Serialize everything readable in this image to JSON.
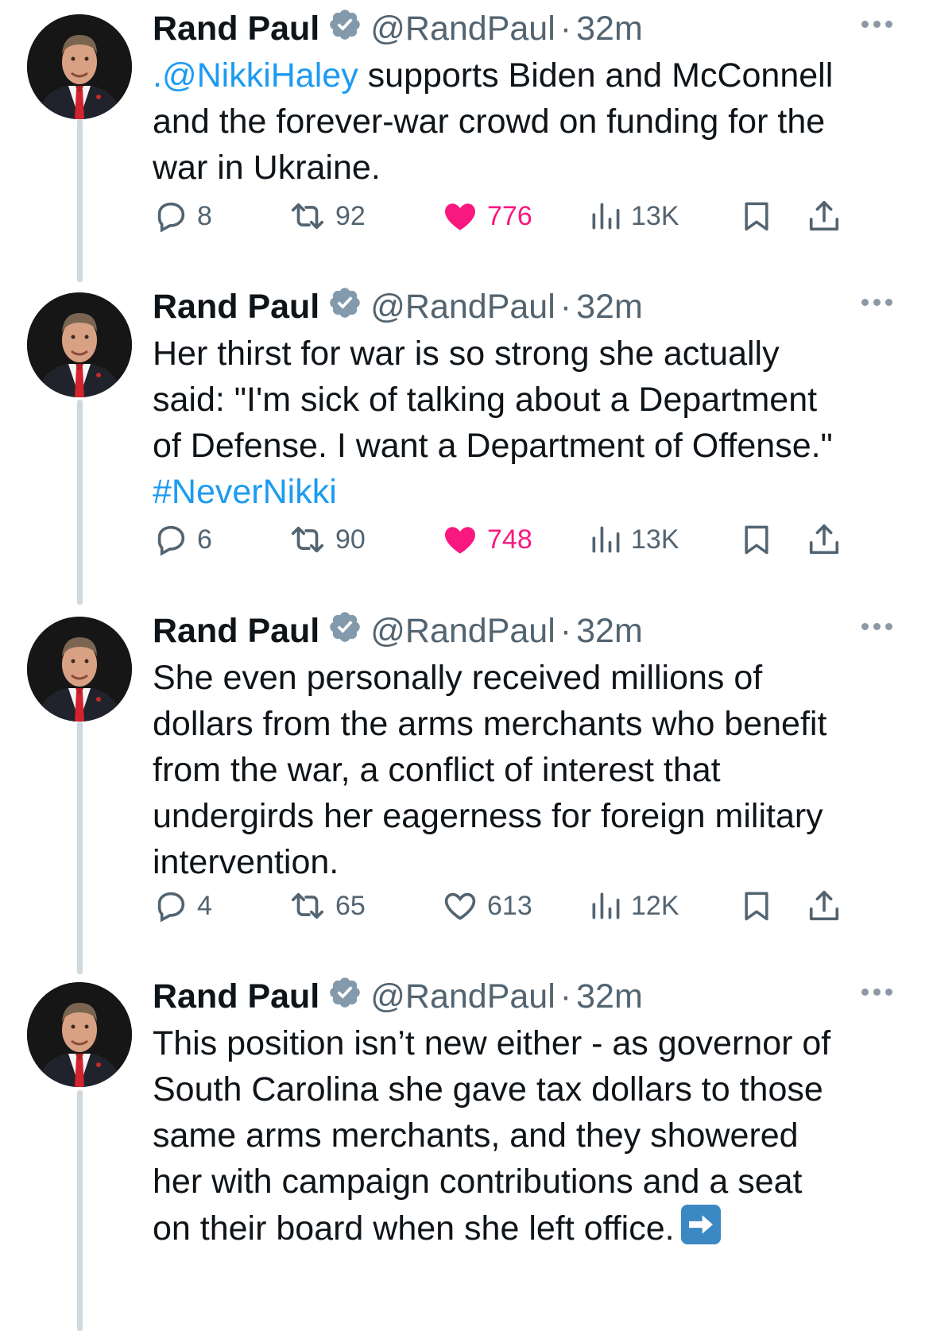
{
  "tweets": [
    {
      "author": "Rand Paul",
      "handle": "@RandPaul",
      "separator": "·",
      "time": "32m",
      "lines": [
        {
          "mention": ".@NikkiHaley",
          "text": " supports Biden and McConnell"
        },
        {
          "text": "and the forever-war crowd on funding for the"
        },
        {
          "text": "war in Ukraine."
        }
      ],
      "replies": "8",
      "reposts": "92",
      "likes": "776",
      "views": "13K",
      "liked": true
    },
    {
      "author": "Rand Paul",
      "handle": "@RandPaul",
      "separator": "·",
      "time": "32m",
      "lines": [
        {
          "text": "Her thirst for war is so strong she actually"
        },
        {
          "text": "said: \"I'm sick of talking about a Department"
        },
        {
          "text": "of Defense. I want a Department of Offense.\""
        },
        {
          "hashtag": "#NeverNikki"
        }
      ],
      "replies": "6",
      "reposts": "90",
      "likes": "748",
      "views": "13K",
      "liked": true
    },
    {
      "author": "Rand Paul",
      "handle": "@RandPaul",
      "separator": "·",
      "time": "32m",
      "lines": [
        {
          "text": "She even personally received millions of"
        },
        {
          "text": "dollars from the arms merchants who benefit"
        },
        {
          "text": "from the war, a conflict of interest that"
        },
        {
          "text": "undergirds her eagerness for foreign military"
        },
        {
          "text": "intervention."
        }
      ],
      "replies": "4",
      "reposts": "65",
      "likes": "613",
      "views": "12K",
      "liked": false
    },
    {
      "author": "Rand Paul",
      "handle": "@RandPaul",
      "separator": "·",
      "time": "32m",
      "lines": [
        {
          "text": "This position isn’t new either - as governor of"
        },
        {
          "text": "South Carolina she gave tax dollars to those"
        },
        {
          "text": "same arms merchants, and they showered"
        },
        {
          "text": "her with campaign contributions and a seat"
        },
        {
          "text": "on their board when she left office."
        }
      ],
      "trailing_icon": "right-arrow-emoji-icon"
    }
  ],
  "colors": {
    "link": "#1d9bf0",
    "like_active": "#f91880",
    "verified_badge": "#829aab",
    "secondary_text": "#536471",
    "thread_line": "#cfd9de"
  }
}
